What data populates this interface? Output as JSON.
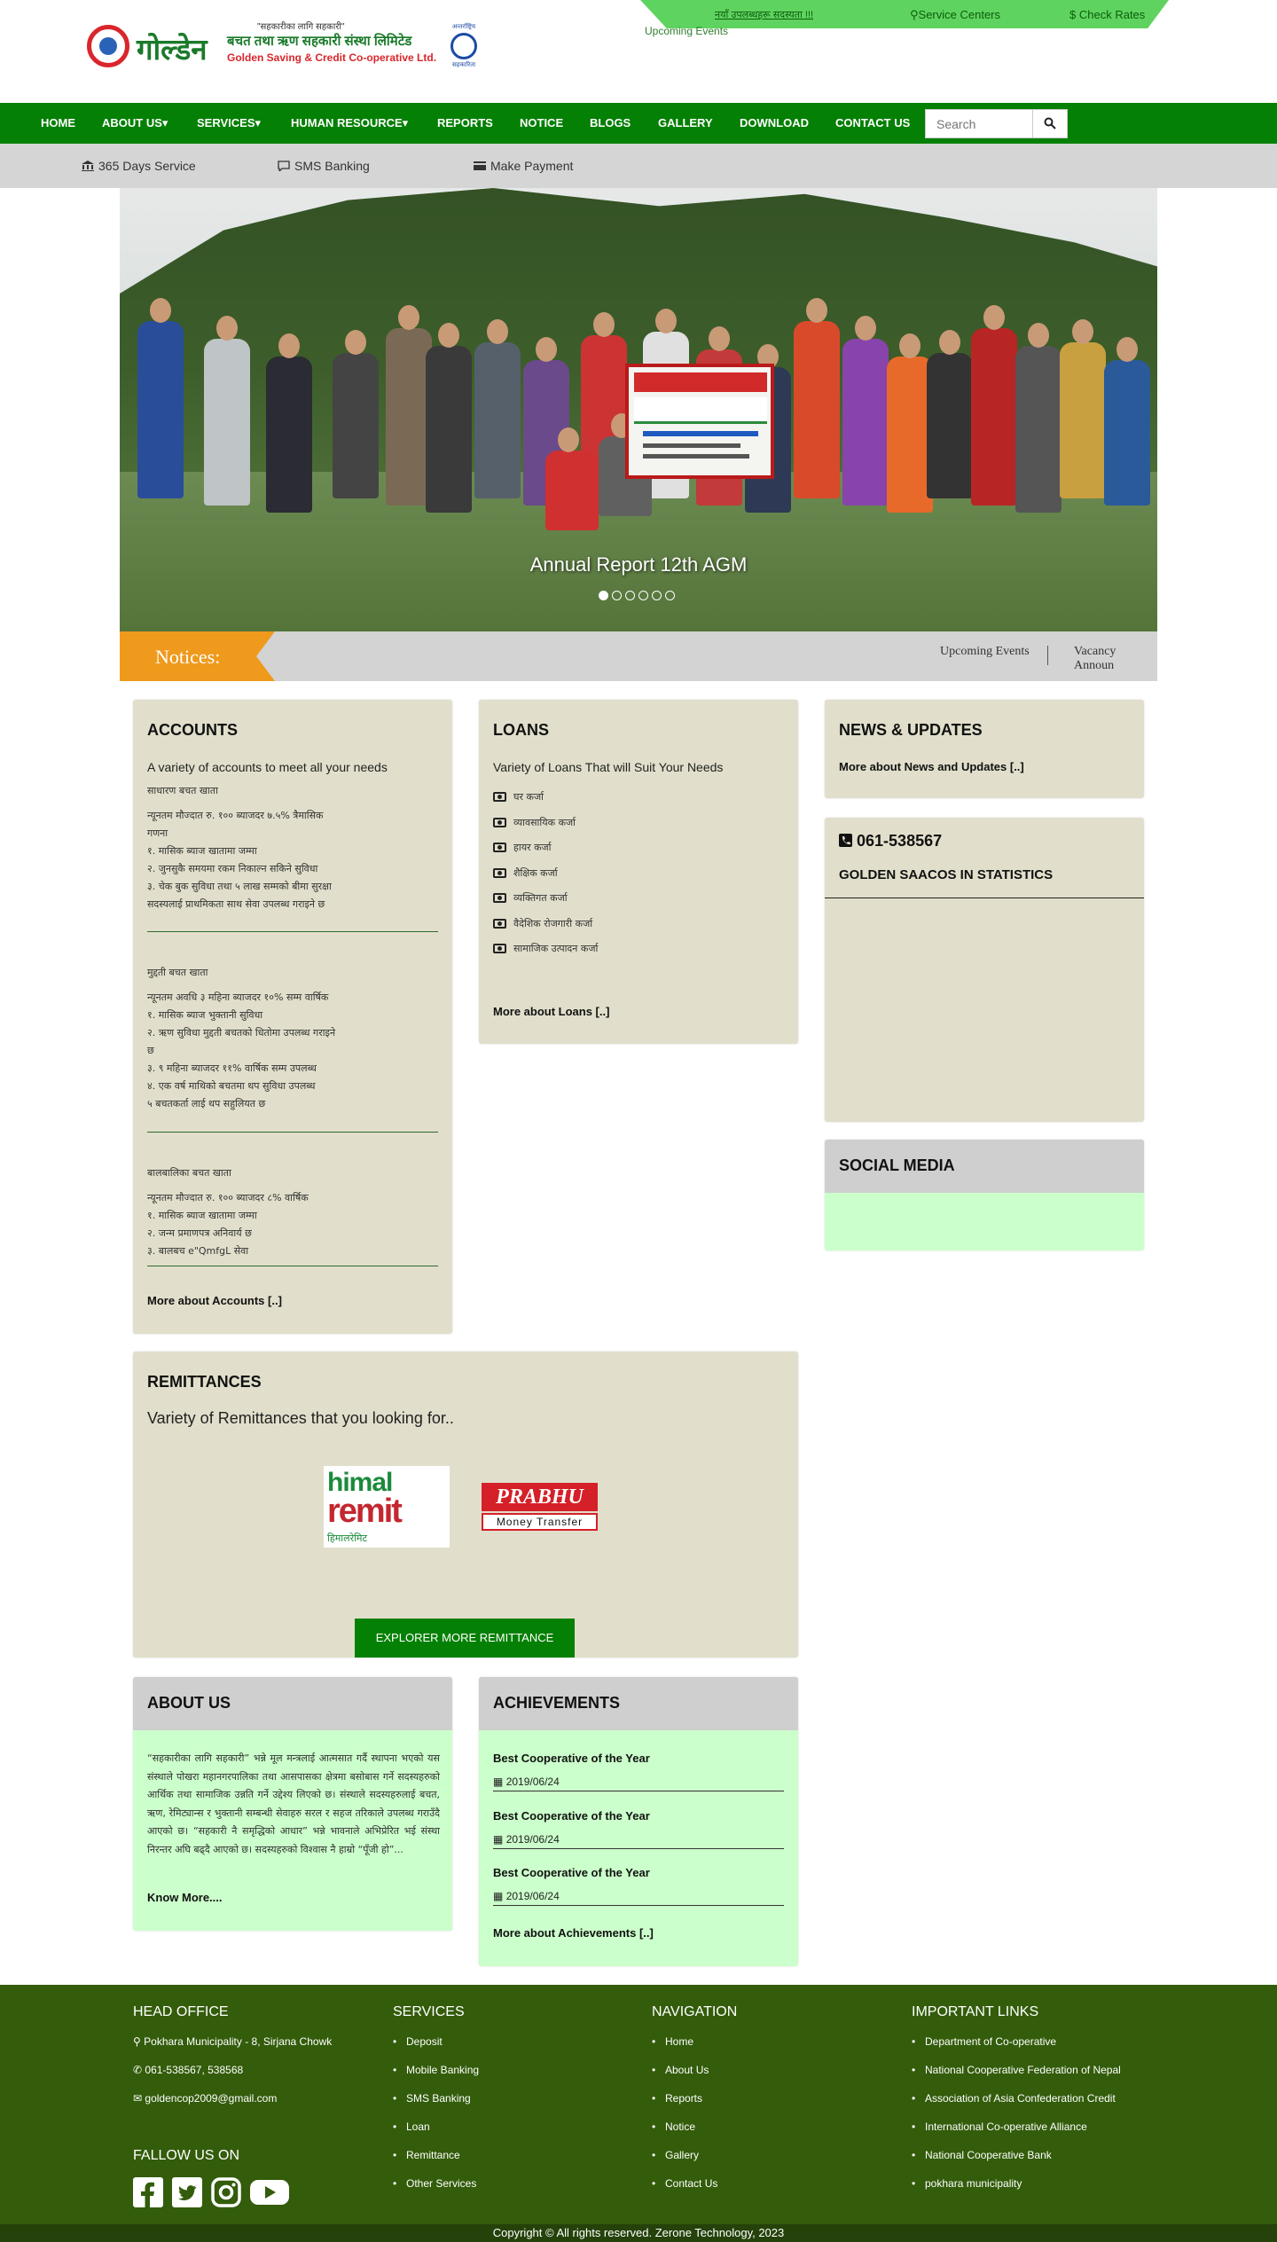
{
  "topbar": {
    "marquee": "नयाँ उपलब्धहरू सदस्यता !!!",
    "service_centers": "Service Centers",
    "check_rates": "Check Rates",
    "upcoming_events": "Upcoming Events"
  },
  "logo": {
    "name_nepali": "गोल्डेन",
    "slogan": "\"सहकारीका लागि सहकारी\"",
    "org_nepali": "बचत तथा ऋण सहकारी संस्था लिमिटेड",
    "org_english": "Golden Saving & Credit Co-operative Ltd.",
    "coop_text_top": "अन्तर्राष्ट्रिय",
    "coop_text_bottom": "सहकारिता"
  },
  "nav": {
    "items": [
      "HOME",
      "ABOUT US▾",
      "SERVICES▾",
      "HUMAN RESOURCE▾",
      "REPORTS",
      "NOTICE",
      "BLOGS",
      "GALLERY",
      "DOWNLOAD",
      "CONTACT US"
    ],
    "search_placeholder": "Search"
  },
  "service_bar": {
    "items": [
      "365 Days Service",
      "SMS Banking",
      "Make Payment"
    ]
  },
  "hero": {
    "caption": "Annual Report 12th AGM",
    "slides": 6,
    "active_slide": 1
  },
  "notices": {
    "label": "Notices:",
    "items": [
      "Upcoming Events",
      "Vacancy Announ"
    ]
  },
  "accounts": {
    "title": "ACCOUNTS",
    "subtitle": "A variety of accounts to meet all your needs",
    "groups": [
      {
        "heading": "साधारण बचत खाता",
        "lines": [
          "न्यूनतम मौज्दात रु. १०० ब्याजदर ७.५% त्रैमासिक",
          "गणना",
          "१. मासिक ब्याज खातामा जम्मा",
          "२. जुनसुकै समयमा रकम निकाल्न सकिने सुविधा",
          "३. चेक बुक सुविधा तथा ५ लाख सम्मको बीमा सुरक्षा",
          "सदस्यलाई प्राथमिकता साथ सेवा उपलब्ध गराइने छ"
        ]
      },
      {
        "heading": "मुद्दती बचत खाता",
        "lines": [
          "न्यूनतम अवधि ३ महिना ब्याजदर १०% सम्म वार्षिक",
          "१. मासिक ब्याज भुक्तानी सुविधा",
          "२. ऋण सुविधा मुद्दती बचतको धितोमा उपलब्ध गराइने",
          "छ",
          "३. ९ महिना ब्याजदर ११% वार्षिक सम्म उपलब्ध",
          "४. एक वर्ष माथिको बचतमा थप सुविधा उपलब्ध",
          "५ बचतकर्ता लाई थप सहुलियत छ"
        ]
      },
      {
        "heading": "बालबालिका बचत खाता",
        "lines": [
          "न्यूनतम मौज्दात रु. १०० ब्याजदर ८% वार्षिक",
          "१. मासिक ब्याज खातामा जम्मा",
          "२. जन्म प्रमाणपत्र अनिवार्य छ",
          "३. बालबच e\"QmfgL सेवा"
        ]
      }
    ],
    "more": "More about Accounts [..]"
  },
  "loans": {
    "title": "LOANS",
    "subtitle": "Variety of Loans That will Suit Your Needs",
    "items": [
      "घर कर्जा",
      "व्यावसायिक कर्जा",
      "हायर कर्जा",
      "शैक्षिक कर्जा",
      "व्यक्तिगत कर्जा",
      "वैदेशिक रोजगारी कर्जा",
      "सामाजिक उत्पादन कर्जा"
    ],
    "more": "More about Loans [..]"
  },
  "news": {
    "title": "NEWS & UPDATES",
    "more": "More about News and Updates [..]"
  },
  "stats": {
    "phone": "061-538567",
    "heading": "GOLDEN SAACOS IN STATISTICS"
  },
  "social": {
    "title": "SOCIAL MEDIA"
  },
  "remittances": {
    "title": "REMITTANCES",
    "subtitle": "Variety of Remittances that you looking for..",
    "himal_top": "himal",
    "himal_mid": "remit",
    "himal_bottom": "हिमालरेमिट",
    "prabhu_top": "PRABHU",
    "prabhu_bottom": "Money Transfer",
    "button": "EXPLORER MORE REMITTANCE"
  },
  "about": {
    "title": "ABOUT US",
    "text": "“सहकारीका लागि सहकारी” भन्ने मूल मन्त्रलाई आत्मसात गर्दै स्थापना भएको यस संस्थाले पोखरा महानगरपालिका तथा आसपासका क्षेत्रमा बसोबास गर्ने सदस्यहरुको आर्थिक तथा सामाजिक उन्नति गर्ने उद्देश्य लिएको छ। संस्थाले सदस्यहरुलाई बचत, ऋण, रेमिट्यान्स र भुक्तानी सम्बन्धी सेवाहरु सरल र सहज तरिकाले उपलब्ध गराउँदै आएको छ। “सहकारी नै समृद्धिको आधार” भन्ने भावनाले अभिप्रेरित भई संस्था निरन्तर अघि बढ्दै आएको छ। सदस्यहरुको विश्वास नै हाम्रो “पूँजी हो”...",
    "more": "Know More...."
  },
  "achievements": {
    "title": "ACHIEVEMENTS",
    "items": [
      {
        "title": "Best Cooperative of the Year",
        "date": "2019/06/24"
      },
      {
        "title": "Best Cooperative of the Year",
        "date": "2019/06/24"
      },
      {
        "title": "Best Cooperative of the Year",
        "date": "2019/06/24"
      }
    ],
    "more": "More about Achievements [..]"
  },
  "footer": {
    "head_office": {
      "title": "HEAD OFFICE",
      "address": "Pokhara Municipality - 8, Sirjana Chowk",
      "phone": "061-538567, 538568",
      "email": "goldencop2009@gmail.com"
    },
    "follow": "FALLOW US ON",
    "services": {
      "title": "SERVICES",
      "items": [
        "Deposit",
        "Mobile Banking",
        "SMS Banking",
        "Loan",
        "Remittance",
        "Other Services"
      ]
    },
    "navigation": {
      "title": "NAVIGATION",
      "items": [
        "Home",
        "About Us",
        "Reports",
        "Notice",
        "Gallery",
        "Contact Us"
      ]
    },
    "links": {
      "title": "IMPORTANT LINKS",
      "items": [
        "Department of Co-operative",
        "National Cooperative Federation of Nepal",
        "Association of Asia Confederation Credit",
        "International Co-operative Alliance",
        "National Cooperative Bank",
        "pokhara municipality"
      ]
    },
    "copyright": "Copyright © All rights reserved. Zerone Technology, 2023"
  },
  "colors": {
    "brand_green": "#048004",
    "top_strip": "#5fd35f",
    "notice_orange": "#ef9a1d",
    "panel_beige": "#e1dfcb",
    "panel_green": "#cbffcb",
    "footer_green": "#335c0b"
  }
}
